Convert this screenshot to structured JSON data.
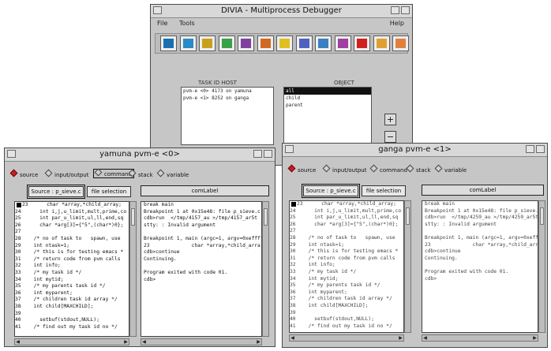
{
  "divia": {
    "title": "DIVIA - Multiprocess Debugger",
    "menu": {
      "file": "File",
      "tools": "Tools",
      "help": "Help"
    },
    "toolbar_icons": [
      "window-icon",
      "window-icon",
      "window-icon",
      "window-icon",
      "chart-icon",
      "chart-icon",
      "flag-icon",
      "grid-icon",
      "grid-icon",
      "grid-icon",
      "stop-icon",
      "chart-icon",
      "chart-icon"
    ],
    "toolbar_colors": [
      "#1a6fb0",
      "#2b8ac8",
      "#c8a020",
      "#3aa04a",
      "#8040a0",
      "#d06a20",
      "#e0c020",
      "#5060c0",
      "#3a80c0",
      "#a040a0",
      "#d02020",
      "#e0a030",
      "#e08040"
    ],
    "col_header_left": "TASK ID HOST",
    "col_header_right": "OBJECT",
    "tasks": [
      "pvm-e <0> 4173 on yamuna",
      "pvm-e <1> 8252 on ganga"
    ],
    "objects": [
      "all",
      "child",
      "parent"
    ],
    "side_buttons": [
      "+",
      "−"
    ]
  },
  "yamuna": {
    "title": "yamuna pvm-e <0>",
    "radios": [
      "source",
      "input/output",
      "command",
      "stack",
      "variable"
    ],
    "source_label": "Source : p_sieve.c",
    "file_selection": "file selection",
    "com_label": "comLabel",
    "code": [
      {
        "n": "23",
        "t": "    char *array,*child_array;"
      },
      {
        "n": "24",
        "t": "    int i,j,u_limit,mult,prime,co"
      },
      {
        "n": "25",
        "t": "    int par_u_limit,ul,ll,end,sq"
      },
      {
        "n": "26",
        "t": "    char *arg[3]={\"5\",(char*)0};"
      },
      {
        "n": "27",
        "t": ""
      },
      {
        "n": "28",
        "t": "  /* no of task to   spawn, use"
      },
      {
        "n": "29",
        "t": "  int ntask=1;"
      },
      {
        "n": "30",
        "t": "  /* this is for testing emacs *"
      },
      {
        "n": "31",
        "t": "  /* return code from pvm calls"
      },
      {
        "n": "32",
        "t": "  int info;"
      },
      {
        "n": "33",
        "t": "  /* my task id */"
      },
      {
        "n": "34",
        "t": "  int mytid;"
      },
      {
        "n": "35",
        "t": "  /* my parents task id */"
      },
      {
        "n": "36",
        "t": "  int myparent;"
      },
      {
        "n": "37",
        "t": "  /* children task id array */"
      },
      {
        "n": "38",
        "t": "  int child[MAXCHILD];"
      },
      {
        "n": "39",
        "t": ""
      },
      {
        "n": "40",
        "t": "    setbuf(stdout,NULL);"
      },
      {
        "n": "41",
        "t": "  /* find out my task id no */"
      }
    ],
    "output": [
      "break main",
      "Breakpoint 1 at 0x15e48: file p_sieve.c",
      "cdb>run  </tmp/4157_au >/tmp/4157_ar5t",
      "stty: : Invalid argument",
      "",
      "Breakpoint 1, main (argc=1, argv=0xeffff",
      "23              char *array,*child_arra",
      "cdb>continue",
      "Continuing.",
      "",
      "Program exited with code 01.",
      "cdb>"
    ]
  },
  "ganga": {
    "title": "ganga pvm-e <1>",
    "radios": [
      "source",
      "input/output",
      "command",
      "stack",
      "variable"
    ],
    "source_label": "Source : p_sieve.c",
    "file_selection": "file selection",
    "com_label": "comLabel",
    "code": [
      {
        "n": "23",
        "t": "    char *array,*child_array;"
      },
      {
        "n": "24",
        "t": "    int i,j,u_limit,mult,prime,co"
      },
      {
        "n": "25",
        "t": "    int par_u_limit,ul,ll,end,sq"
      },
      {
        "n": "26",
        "t": "    char *arg[3]={\"5\",(char*)0};"
      },
      {
        "n": "27",
        "t": ""
      },
      {
        "n": "28",
        "t": "  /* no of task to   spawn, use"
      },
      {
        "n": "29",
        "t": "  int ntask=1;"
      },
      {
        "n": "30",
        "t": "  /* this is for testing emacs *"
      },
      {
        "n": "31",
        "t": "  /* return code from pvm calls"
      },
      {
        "n": "32",
        "t": "  int info;"
      },
      {
        "n": "33",
        "t": "  /* my task id */"
      },
      {
        "n": "34",
        "t": "  int mytid;"
      },
      {
        "n": "35",
        "t": "  /* my parents task id */"
      },
      {
        "n": "36",
        "t": "  int myparent;"
      },
      {
        "n": "37",
        "t": "  /* children task id array */"
      },
      {
        "n": "38",
        "t": "  int child[MAXCHILD];"
      },
      {
        "n": "39",
        "t": ""
      },
      {
        "n": "40",
        "t": "    setbuf(stdout,NULL);"
      },
      {
        "n": "41",
        "t": "  /* find out my task id no */"
      }
    ],
    "output": [
      "break main",
      "Breakpoint 1 at 0x15e48: file p_sieve.c",
      "cdb>run  </tmp/4259_au >/tmp/4259_ar5t",
      "stty: : Invalid argument",
      "",
      "Breakpoint 1, main (argc=1, argv=0xeffff",
      "23              char *array,*child_arra",
      "cdb>continue",
      "Continuing.",
      "",
      "Program exited with code 01.",
      "cdb>"
    ]
  }
}
